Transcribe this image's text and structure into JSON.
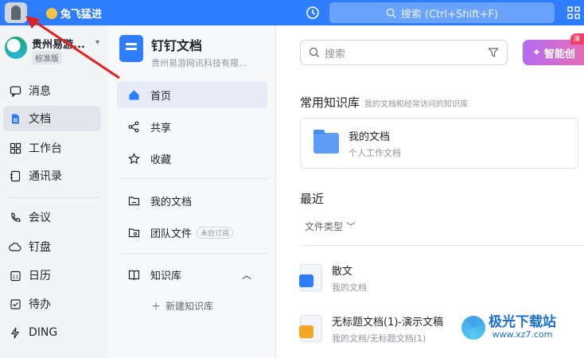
{
  "topbar": {
    "user_name": "兔飞猛进",
    "search_placeholder": "搜索 (Ctrl+Shift+F)"
  },
  "org": {
    "name": "贵州易游...",
    "edition": "标准版"
  },
  "leftnav": {
    "items": [
      {
        "label": "消息"
      },
      {
        "label": "文档"
      },
      {
        "label": "工作台"
      },
      {
        "label": "通讯录"
      },
      {
        "label": "会议"
      },
      {
        "label": "钉盘"
      },
      {
        "label": "日历"
      },
      {
        "label": "待办"
      },
      {
        "label": "DING"
      }
    ]
  },
  "docpanel": {
    "title": "钉钉文档",
    "subtitle": "贵州易游网讯科技有限...",
    "items": [
      {
        "label": "首页"
      },
      {
        "label": "共享"
      },
      {
        "label": "收藏"
      },
      {
        "label": "我的文档"
      },
      {
        "label": "团队文件"
      },
      {
        "label": "知识库"
      }
    ],
    "team_badge": "未自订阅",
    "new_kb": "新建知识库"
  },
  "main": {
    "search_placeholder": "搜索",
    "ai_button": "智能创",
    "ai_badge": "清",
    "common_kb_title": "常用知识库",
    "common_kb_sub": "我的文档和经常访问的知识库",
    "kb_card": {
      "name": "我的文档",
      "desc": "个人工作文档"
    },
    "recent_title": "最近",
    "file_type": "文件类型",
    "docs": [
      {
        "name": "散文",
        "path": "我的文档"
      },
      {
        "name": "无标题文档(1)-演示文稿",
        "path": "我的文档/无标题文档(1)"
      }
    ]
  },
  "watermark": {
    "brand": "极光下载站",
    "url": "www.xz7.com"
  },
  "colors": {
    "accent": "#2f7dff",
    "sidebar_bg": "#f3f4f6",
    "panel_bg": "#f7f8fa"
  }
}
